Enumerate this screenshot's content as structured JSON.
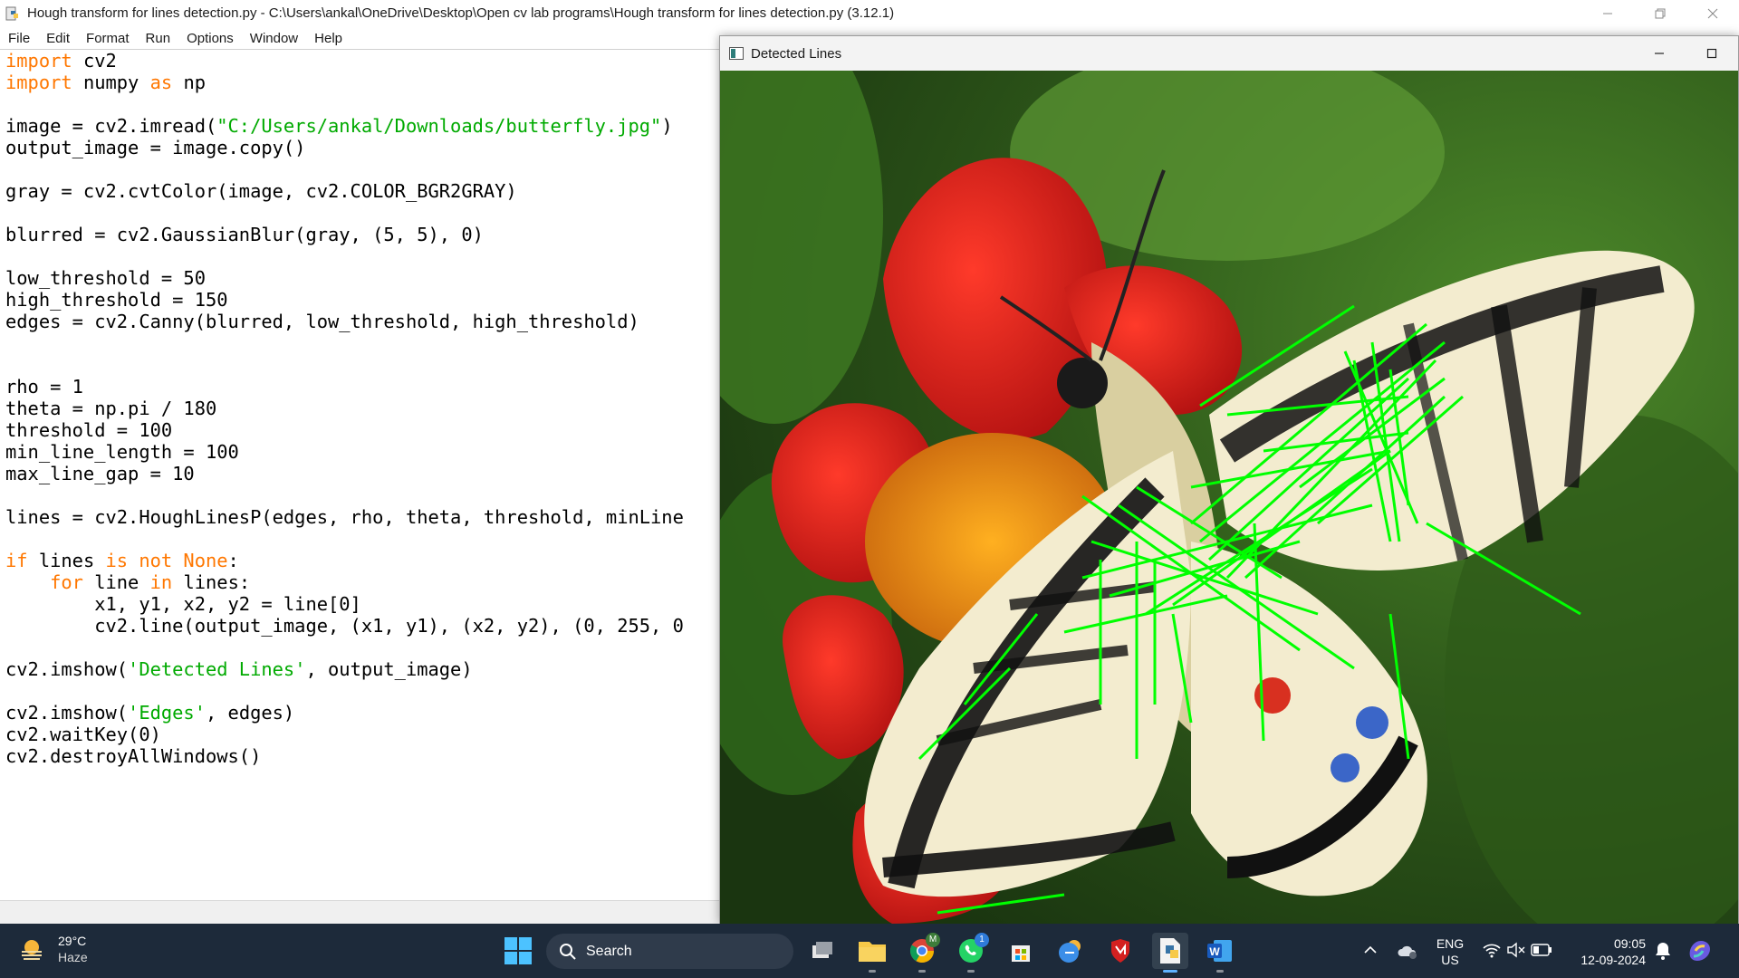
{
  "idle": {
    "title": "Hough transform for lines detection.py - C:\\Users\\ankal\\OneDrive\\Desktop\\Open cv lab programs\\Hough transform for lines detection.py (3.12.1)",
    "menu": [
      "File",
      "Edit",
      "Format",
      "Run",
      "Options",
      "Window",
      "Help"
    ],
    "code": {
      "l1_kw": "import",
      "l1_rest": " cv2",
      "l2_kw": "import",
      "l2_mid": " numpy ",
      "l2_kw2": "as",
      "l2_rest": " np",
      "l4_a": "image = cv2.imread(",
      "l4_str": "\"C:/Users/ankal/Downloads/butterfly.jpg\"",
      "l4_b": ")",
      "l5": "output_image = image.copy()",
      "l7": "gray = cv2.cvtColor(image, cv2.COLOR_BGR2GRAY)",
      "l9": "blurred = cv2.GaussianBlur(gray, (5, 5), 0)",
      "l11": "low_threshold = 50",
      "l12": "high_threshold = 150",
      "l13": "edges = cv2.Canny(blurred, low_threshold, high_threshold)",
      "l16": "rho = 1",
      "l17": "theta = np.pi / 180",
      "l18": "threshold = 100",
      "l19": "min_line_length = 100",
      "l20": "max_line_gap = 10",
      "l22": "lines = cv2.HoughLinesP(edges, rho, theta, threshold, minLine",
      "l24_kw1": "if",
      "l24_a": " lines ",
      "l24_kw2": "is not None",
      "l24_b": ":",
      "l25_ind": "    ",
      "l25_kw1": "for",
      "l25_a": " line ",
      "l25_kw2": "in",
      "l25_b": " lines:",
      "l26": "        x1, y1, x2, y2 = line[0]",
      "l27": "        cv2.line(output_image, (x1, y1), (x2, y2), (0, 255, 0",
      "l29_a": "cv2.imshow(",
      "l29_str": "'Detected Lines'",
      "l29_b": ", output_image)",
      "l31_a": "cv2.imshow(",
      "l31_str": "'Edges'",
      "l31_b": ", edges)",
      "l32": "cv2.waitKey(0)",
      "l33": "cv2.destroyAllWindows()"
    }
  },
  "cv_window": {
    "title": "Detected Lines"
  },
  "taskbar": {
    "weather_temp": "29°C",
    "weather_cond": "Haze",
    "search_label": "Search",
    "whatsapp_badge": "1",
    "chrome_badge": "M",
    "lang_top": "ENG",
    "lang_bottom": "US",
    "time": "09:05",
    "date": "12-09-2024"
  },
  "colors": {
    "keyword": "#ff7700",
    "string": "#00aa00",
    "detected_line": "#00ff00",
    "taskbar_bg": "#1d2a3a"
  }
}
